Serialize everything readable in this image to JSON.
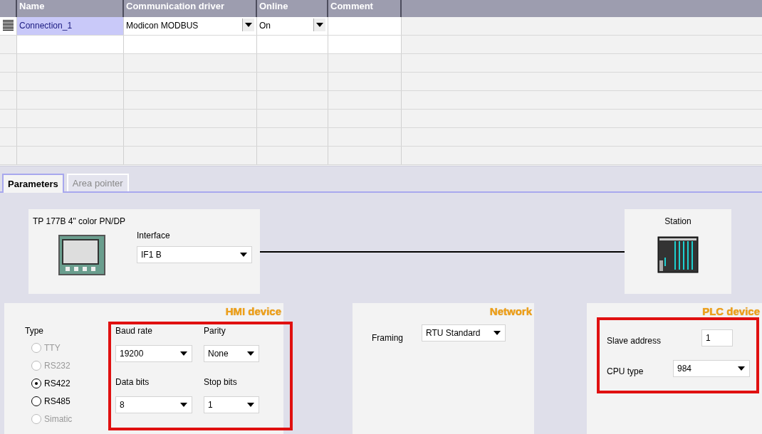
{
  "table": {
    "columns": [
      "Name",
      "Communication driver",
      "Online",
      "Comment"
    ],
    "rows": [
      {
        "name": "Connection_1",
        "driver": "Modicon MODBUS",
        "online": "On",
        "comment": "",
        "selected": true
      }
    ]
  },
  "tabs": [
    {
      "label": "Parameters",
      "selected": true
    },
    {
      "label": "Area pointer",
      "selected": false
    }
  ],
  "device": {
    "title": "TP 177B 4\" color PN/DP",
    "interface_label": "Interface",
    "interface_value": "IF1 B"
  },
  "station": {
    "title": "Station"
  },
  "hmi": {
    "title": "HMI device",
    "type_label": "Type",
    "types": [
      {
        "label": "TTY",
        "selected": false,
        "disabled": true
      },
      {
        "label": "RS232",
        "selected": false,
        "disabled": true
      },
      {
        "label": "RS422",
        "selected": true,
        "disabled": false
      },
      {
        "label": "RS485",
        "selected": false,
        "disabled": false
      },
      {
        "label": "Simatic",
        "selected": false,
        "disabled": true
      }
    ],
    "fields": [
      {
        "label": "Baud rate",
        "value": "19200"
      },
      {
        "label": "Parity",
        "value": "None"
      },
      {
        "label": "Data bits",
        "value": "8"
      },
      {
        "label": "Stop bits",
        "value": "1"
      }
    ]
  },
  "network": {
    "title": "Network",
    "framing_label": "Framing",
    "framing_value": "RTU Standard"
  },
  "plc": {
    "title": "PLC device",
    "slave_label": "Slave address",
    "slave_value": "1",
    "cpu_label": "CPU type",
    "cpu_value": "984"
  }
}
